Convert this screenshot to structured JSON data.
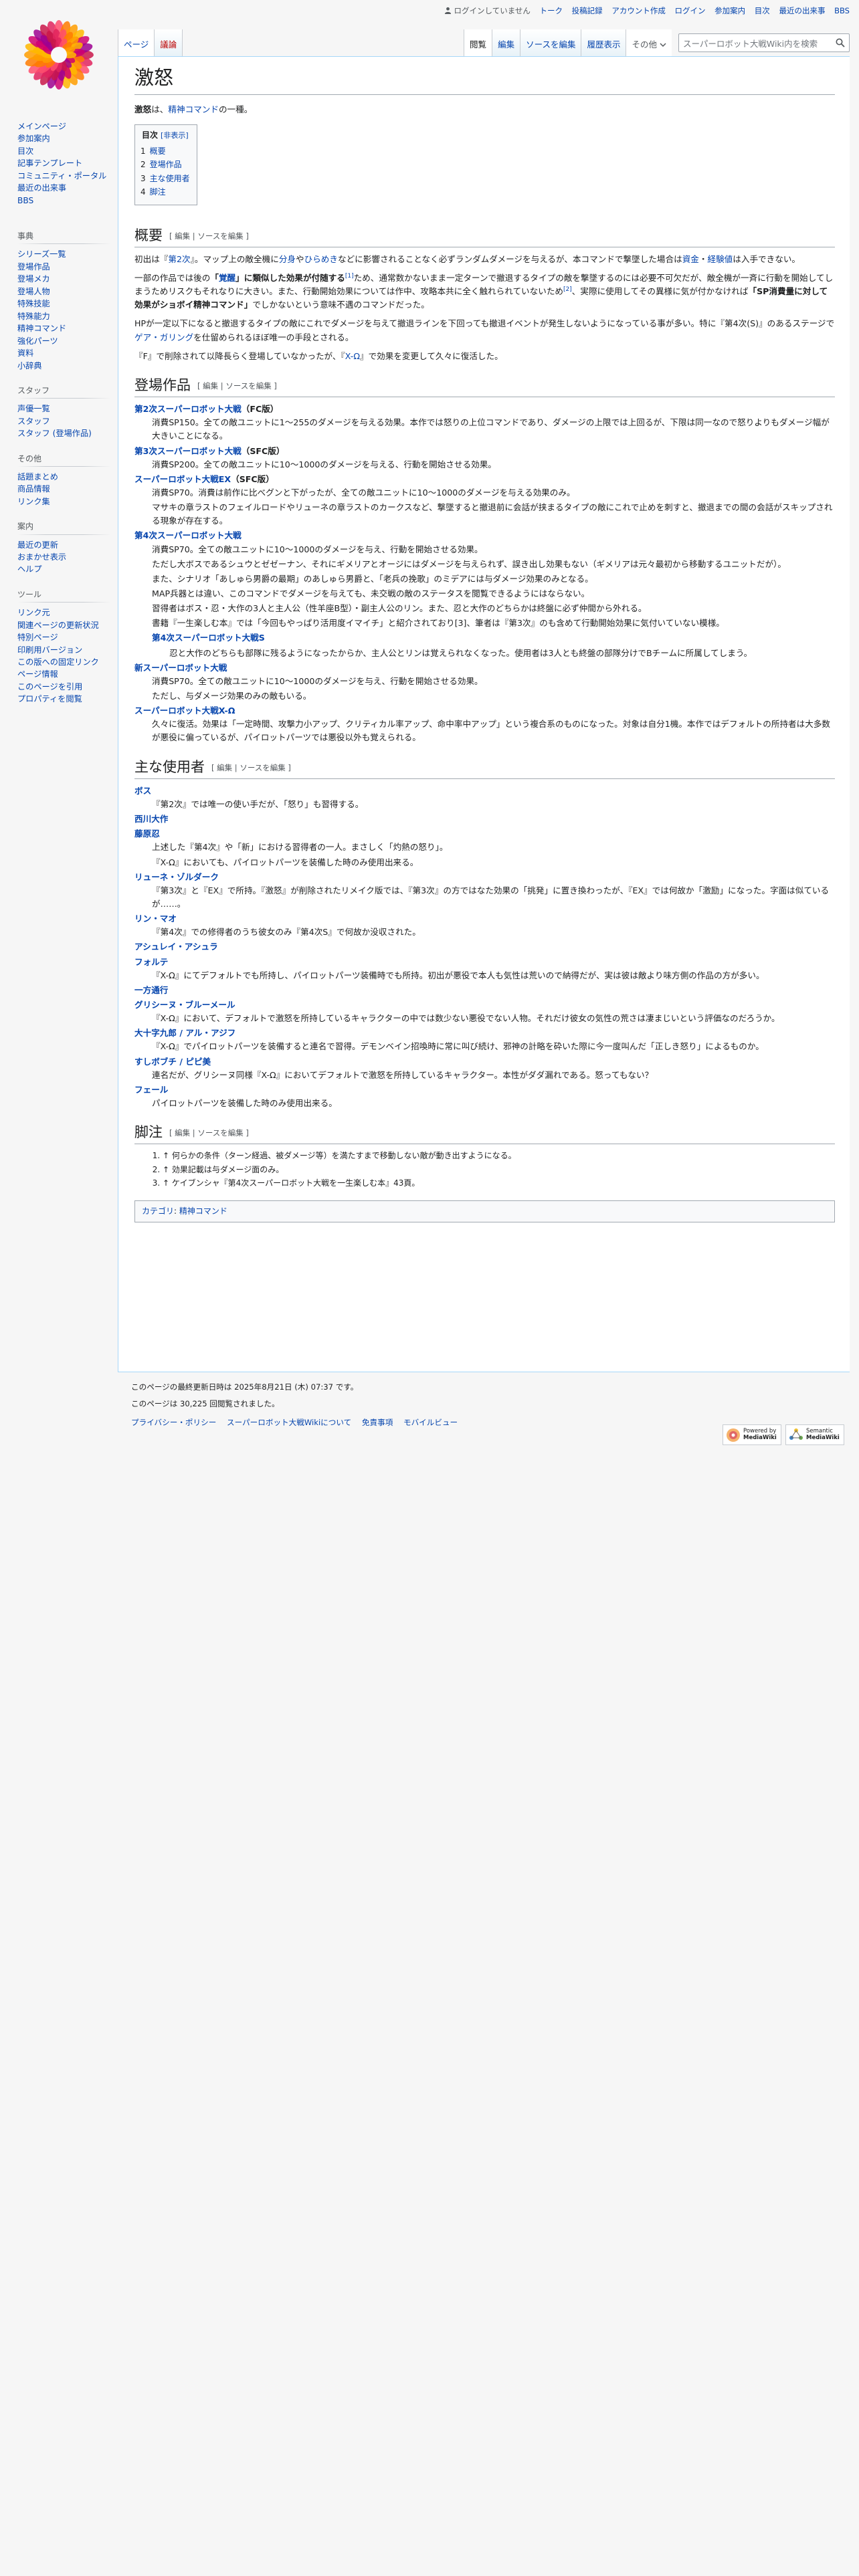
{
  "personal": {
    "not_logged_in": "ログインしていません",
    "talk": "トーク",
    "contributions": "投稿記録",
    "create_account": "アカウント作成",
    "login": "ログイン",
    "items": [
      "参加案内",
      "目次",
      "最近の出来事",
      "BBS"
    ]
  },
  "tabs": {
    "page": "ページ",
    "discussion": "議論",
    "read": "閲覧",
    "edit": "編集",
    "edit_source": "ソースを編集",
    "history": "履歴表示",
    "more": "その他",
    "search_placeholder": "スーパーロボット大戦Wiki内を検索"
  },
  "sidebar": {
    "main": [
      "メインページ",
      "参加案内",
      "目次",
      "記事テンプレート",
      "コミュニティ・ポータル",
      "最近の出来事",
      "BBS"
    ],
    "dict_heading": "事典",
    "dict": [
      "シリーズ一覧",
      "登場作品",
      "登場メカ",
      "登場人物",
      "特殊技能",
      "特殊能力",
      "精神コマンド",
      "強化パーツ",
      "資料",
      "小辞典"
    ],
    "staff_heading": "スタッフ",
    "staff": [
      "声優一覧",
      "スタッフ",
      "スタッフ (登場作品)"
    ],
    "other_heading": "その他",
    "other": [
      "話題まとめ",
      "商品情報",
      "リンク集"
    ],
    "nav_heading": "案内",
    "nav": [
      "最近の更新",
      "おまかせ表示",
      "ヘルプ"
    ],
    "tools_heading": "ツール",
    "tools": [
      "リンク元",
      "関連ページの更新状況",
      "特別ページ",
      "印刷用バージョン",
      "この版への固定リンク",
      "ページ情報",
      "このページを引用",
      "プロパティを閲覧"
    ]
  },
  "article": {
    "title": "激怒",
    "lead_term": "激怒",
    "lead_mid": "は、",
    "lead_link": "精神コマンド",
    "lead_end": "の一種。",
    "toc": {
      "title": "目次",
      "toggle": "[非表示]",
      "items": [
        {
          "num": "1",
          "label": "概要"
        },
        {
          "num": "2",
          "label": "登場作品"
        },
        {
          "num": "3",
          "label": "主な使用者"
        },
        {
          "num": "4",
          "label": "脚注"
        }
      ]
    },
    "edit_links": "[ 編集 | ソースを編集 ]",
    "sections": {
      "overview": "概要",
      "appearances": "登場作品",
      "users": "主な使用者",
      "notes": "脚注"
    },
    "overview": {
      "p1_a": "初出は『",
      "p1_link1": "第2次",
      "p1_b": "』。マップ上の敵全機に",
      "p1_link2": "分身",
      "p1_c": "や",
      "p1_link3": "ひらめき",
      "p1_d": "などに影響されることなく必ずランダムダメージを与えるが、本コマンドで撃墜した場合は",
      "p1_link4": "資金",
      "p1_e": "・",
      "p1_link5": "経験値",
      "p1_f": "は入手できない。",
      "p2_a": "一部の作品では後の",
      "p2_b": "「",
      "p2_link": "覚醒",
      "p2_c": "」に類似した効果が付随する",
      "p2_ref1": "[1]",
      "p2_d": "ため、通常数かないまま一定ターンで撤退するタイプの敵を撃墜するのには必要不可欠だが、敵全機が一斉に行動を開始してしまうためリスクもそれなりに大きい。また、行動開始効果については作中、攻略本共に全く触れられていないため",
      "p2_ref2": "[2]",
      "p2_e": "、実際に使用してその異様に気が付かなければ",
      "p2_f": "「SP消費量に対して効果がショボイ精神コマンド」",
      "p2_g": "でしかないという意味不遇のコマンドだった。",
      "p3": "HPが一定以下になると撤退するタイプの敵にこれでダメージを与えて撤退ラインを下回っても撤退イベントが発生しないようになっている事が多い。特に『第4次(S)』のあるステージで",
      "p3_link": "ゲア・ガリング",
      "p3_end": "を仕留められるほぼ唯一の手段とされる。",
      "p4_a": "『F』で削除されて以降長らく登場していなかったが、『",
      "p4_link": "X-Ω",
      "p4_b": "』で効果を変更して久々に復活した。"
    },
    "appearances": [
      {
        "title": "第2次スーパーロボット大戦",
        "suffix": "（FC版）",
        "lines": [
          "消費SP150。全ての敵ユニットに1〜255のダメージを与える効果。本作では怒りの上位コマンドであり、ダメージの上限では上回るが、下限は同一なので怒りよりもダメージ幅が大きいことになる。"
        ]
      },
      {
        "title": "第3次スーパーロボット大戦",
        "suffix": "（SFC版）",
        "lines": [
          "消費SP200。全ての敵ユニットに10〜1000のダメージを与える、行動を開始させる効果。"
        ]
      },
      {
        "title": "スーパーロボット大戦EX",
        "suffix": "（SFC版）",
        "lines": [
          "消費SP70。消費は前作に比べグンと下がったが、全ての敵ユニットに10〜1000のダメージを与える効果のみ。",
          "マサキの章ラストのフェイルロードやリューネの章ラストのカークスなど、撃墜すると撤退前に会話が挟まるタイプの敵にこれで止めを刺すと、撤退までの間の会話がスキップされる現象が存在する。"
        ]
      },
      {
        "title": "第4次スーパーロボット大戦",
        "suffix": "",
        "lines": [
          "消費SP70。全ての敵ユニットに10〜1000のダメージを与え、行動を開始させる効果。",
          "ただし大ボスであるシュウとゼゼーナン、それにギメリアとオージにはダメージを与えられず、誤き出し効果もない（ギメリアは元々最初から移動するユニットだが）。",
          "また、シナリオ「あしゅら男爵の最期」のあしゅら男爵と、「老兵の挽歌」のミデアには与ダメージ効果のみとなる。",
          "MAP兵器とは違い、このコマンドでダメージを与えても、未交戦の敵のステータスを閲覧できるようにはならない。",
          "習得者はボス・忍・大作の3人と主人公（性羊座B型）・副主人公のリン。また、忍と大作のどちらかは終盤に必ず仲間から外れる。",
          "書籍『一生楽しむ本』では「今回もやっぱり活用度イマイチ」と紹介されており[3]、筆者は『第3次』のも含めて行動開始効果に気付いていない模様。"
        ],
        "sub": {
          "title": "第4次スーパーロボット大戦S",
          "lines": [
            "忍と大作のどちらも部隊に残るようになったからか、主人公とリンは覚えられなくなった。使用者は3人とも終盤の部隊分けでBチームに所属してしまう。"
          ]
        }
      },
      {
        "title": "新スーパーロボット大戦",
        "suffix": "",
        "lines": [
          "消費SP70。全ての敵ユニットに10〜1000のダメージを与え、行動を開始させる効果。",
          "ただし、与ダメージ効果のみの敵もいる。"
        ]
      },
      {
        "title": "スーパーロボット大戦X-Ω",
        "suffix": "",
        "lines": [
          "久々に復活。効果は「一定時間、攻撃力小アップ、クリティカル率アップ、命中率中アップ」という複合系のものになった。対象は自分1機。本作ではデフォルトの所持者は大多数が悪役に偏っているが、パイロットパーツでは悪役以外も覚えられる。"
        ]
      }
    ],
    "users": [
      {
        "name": "ボス",
        "lines": [
          "『第2次』では唯一の使い手だが、「怒り」も習得する。"
        ]
      },
      {
        "name": "西川大作",
        "lines": []
      },
      {
        "name": "藤原忍",
        "lines": [
          "上述した『第4次』や「新」における習得者の一人。まさしく「灼熱の怒り」。",
          "『X-Ω』においても、パイロットパーツを装備した時のみ使用出来る。"
        ]
      },
      {
        "name": "リューネ・ゾルダーク",
        "lines": [
          "『第3次』と『EX』で所持。『激怒』が削除されたリメイク版では、『第3次』の方ではなた効果の「挑発」に置き換わったが、『EX』では何故か「激励」になった。字面は似ているが……。"
        ]
      },
      {
        "name": "リン・マオ",
        "lines": [
          "『第4次』での修得者のうち彼女のみ『第4次S』で何故か没収された。"
        ]
      },
      {
        "name": "アシュレイ・アシュラ",
        "lines": []
      },
      {
        "name": "フォルテ",
        "lines": [
          "『X-Ω』にてデフォルトでも所持し、パイロットパーツ装備時でも所持。初出が悪役で本人も気性は荒いので納得だが、実は彼は敵より味方側の作品の方が多い。"
        ]
      },
      {
        "name": "一方通行",
        "lines": []
      },
      {
        "name": "グリシーヌ・ブルーメール",
        "lines": [
          "『X-Ω』において、デフォルトで激怒を所持しているキャラクターの中では数少ない悪役でない人物。それだけ彼女の気性の荒さは凄まじいという評価なのだろうか。"
        ]
      },
      {
        "name": "大十字九郎 / アル・アジフ",
        "lines": [
          "『X-Ω』でパイロットパーツを装備すると連名で習得。デモンベイン招喚時に常に叫び続け、邪神の計略を砕いた際に今一度叫んだ「正しき怒り」によるものか。"
        ]
      },
      {
        "name": "すしボブチ / ピピ美",
        "lines": [
          "連名だが、グリシーヌ同様『X-Ω』においてデフォルトで激怒を所持しているキャラクター。本性がダダ漏れである。怒ってもない？"
        ]
      },
      {
        "name": "フェール",
        "lines": [
          "パイロットパーツを装備した時のみ使用出来る。"
        ]
      }
    ],
    "notes": [
      "↑ 何らかの条件（ターン経過、被ダメージ等）を満たすまで移動しない敵が動き出すようになる。",
      "↑ 効果記載は与ダメージ面のみ。",
      "↑ ケイブンシャ『第4次スーパーロボット大戦を一生楽しむ本』43頁。"
    ],
    "category_label": "カテゴリ",
    "category": "精神コマンド"
  },
  "footer": {
    "lastmod": "このページの最終更新日時は 2025年8月21日 (木) 07:37 です。",
    "views": "このページは 30,225 回閲覧されました。",
    "places": [
      "プライバシー・ポリシー",
      "スーパーロボット大戦Wikiについて",
      "免責事項",
      "モバイルビュー"
    ],
    "badge1_a": "Powered by",
    "badge1_b": "MediaWiki",
    "badge2_a": "Semantic",
    "badge2_b": "MediaWiki"
  }
}
